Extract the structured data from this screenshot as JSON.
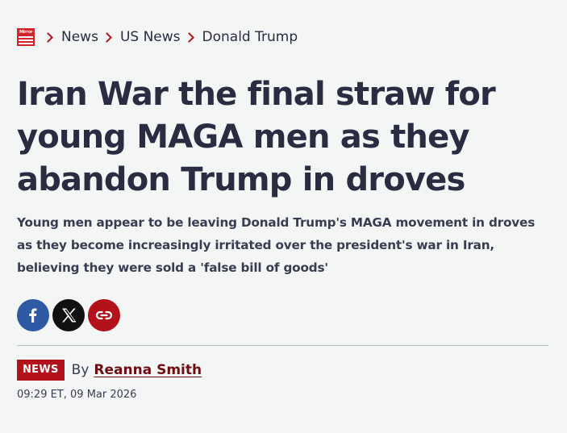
{
  "breadcrumb": {
    "logo_text": "Mirror",
    "items": [
      {
        "label": "News"
      },
      {
        "label": "US News"
      },
      {
        "label": "Donald Trump"
      }
    ]
  },
  "article": {
    "headline": "Iran War the final straw for young MAGA men as they abandon Trump in droves",
    "standfirst": "Young men appear to be leaving Donald Trump's MAGA movement in droves as they become increasingly irritated over the president's war in Iran, believing they were sold a 'false bill of goods'",
    "section_badge": "NEWS",
    "by_prefix": "By",
    "author": "Reanna Smith",
    "timestamp": "09:29 ET, 09 Mar 2026"
  },
  "share": {
    "buttons": [
      {
        "icon": "facebook-icon",
        "color": "#2f59a3"
      },
      {
        "icon": "x-icon",
        "color": "#111111"
      },
      {
        "icon": "link-icon",
        "color": "#b3121a"
      }
    ]
  },
  "colors": {
    "accent": "#b3121a",
    "text": "#2b2b42",
    "background": "#f4f5f5"
  }
}
